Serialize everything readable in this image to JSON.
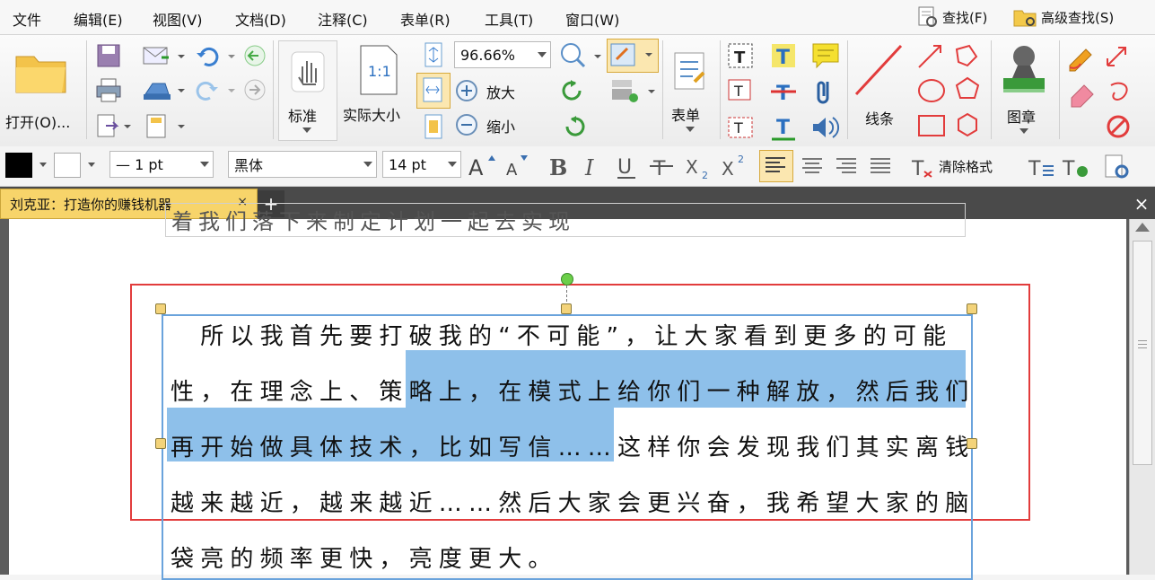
{
  "menubar": {
    "items": [
      "文件",
      "编辑(E)",
      "视图(V)",
      "文档(D)",
      "注释(C)",
      "表单(R)",
      "工具(T)",
      "窗口(W)"
    ],
    "find": "查找(F)",
    "advanced_find": "高级查找(S)"
  },
  "ribbon": {
    "open": "打开(O)...",
    "hand": "标准",
    "actual_size": "实际大小",
    "zoom_value": "96.66%",
    "zoom_in": "放大",
    "zoom_out": "缩小",
    "form": "表单",
    "line": "线条",
    "stamp": "图章"
  },
  "format": {
    "line_width": "— 1 pt",
    "font": "黑体",
    "font_size": "14 pt",
    "clear_format": "清除格式"
  },
  "tab": {
    "title": "刘克亚：打造你的赚钱机器",
    "close": "×",
    "add": "+",
    "close_doc": "×"
  },
  "document": {
    "prev_line": "着我们落下来制定计划一起去实现",
    "lines": [
      "　所以我首先要打破我的“不可能”，让大家看到更多的可能",
      "性，在理念上、策略上，在模式上给你们一种解放，然后我们",
      "再开始做具体技术，比如写信……这样你会发现我们其实离钱",
      "越来越近，越来越近……然后大家会更兴奋，我希望大家的脑",
      "袋亮的频率更快，亮度更大。"
    ]
  },
  "colors": {
    "selection": "#8ec0ea",
    "annotation_border": "#e23c3c",
    "textbox_border": "#5b9bd5",
    "tab_active": "#f7d46a"
  }
}
